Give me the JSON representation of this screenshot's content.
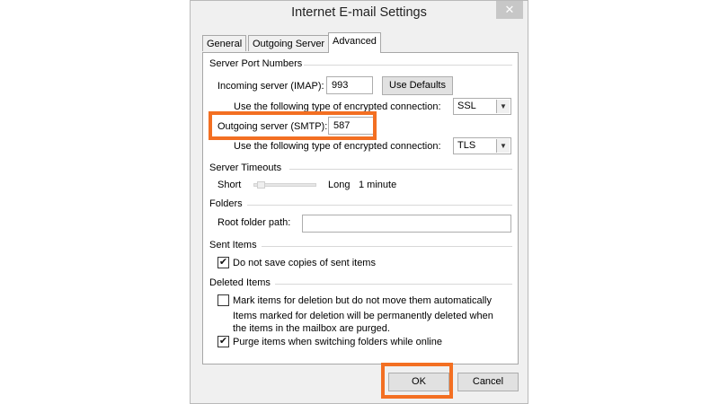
{
  "window": {
    "title": "Internet E-mail Settings",
    "close_glyph": "✕"
  },
  "tabs": [
    {
      "label": "General"
    },
    {
      "label": "Outgoing Server"
    },
    {
      "label": "Advanced"
    }
  ],
  "port_numbers": {
    "heading": "Server Port Numbers",
    "incoming_label": "Incoming server (IMAP):",
    "incoming_value": "993",
    "use_defaults": "Use Defaults",
    "encryption_label": "Use the following type of encrypted connection:",
    "incoming_encryption": "SSL",
    "outgoing_label": "Outgoing server (SMTP):",
    "outgoing_value": "587",
    "outgoing_encryption": "TLS"
  },
  "timeouts": {
    "heading": "Server Timeouts",
    "short_label": "Short",
    "long_label": "Long",
    "value": "1 minute",
    "slider_position": 0.05
  },
  "folders": {
    "heading": "Folders",
    "root_label": "Root folder path:",
    "root_value": ""
  },
  "sent_items": {
    "heading": "Sent Items",
    "no_save_label": "Do not save copies of sent items",
    "no_save_checked": true
  },
  "deleted_items": {
    "heading": "Deleted Items",
    "mark_label": "Mark items for deletion but do not move them automatically",
    "mark_checked": false,
    "note_line1": "Items marked for deletion will be permanently deleted when",
    "note_line2": "the items in the mailbox are purged.",
    "purge_label": "Purge items when switching folders while online",
    "purge_checked": true
  },
  "buttons": {
    "ok": "OK",
    "cancel": "Cancel"
  },
  "colors": {
    "highlight": "#f36f22",
    "check": "✔"
  }
}
